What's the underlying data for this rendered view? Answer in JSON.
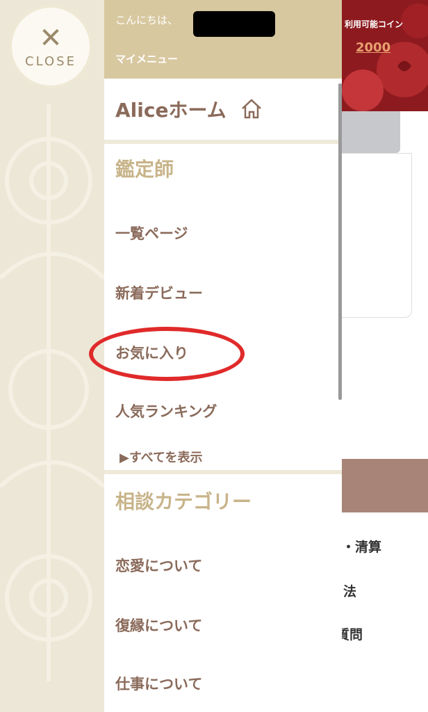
{
  "close": {
    "label": "CLOSE",
    "icon": "close-icon"
  },
  "header": {
    "greeting": "こんにちは、",
    "mymenu": "マイメニュー"
  },
  "home": {
    "label": "Aliceホーム",
    "icon": "home-icon"
  },
  "sections": {
    "readers": {
      "title": "鑑定師",
      "items": [
        "一覧ページ",
        "新着デビュー",
        "お気に入り",
        "人気ランキング"
      ],
      "show_all": "▶すべてを表示"
    },
    "categories": {
      "title": "相談カテゴリー",
      "items": [
        "恋愛について",
        "復縁について",
        "仕事について"
      ]
    }
  },
  "right_page": {
    "coin_label": "利用可能コイン",
    "coin_value": "2000",
    "texts": [
      "・清算",
      "法",
      "質問"
    ]
  },
  "colors": {
    "header_bg": "#d8c8a0",
    "section_title": "#c8b48a",
    "item_text": "#8a6a5a",
    "highlight_circle": "#e02a2a"
  }
}
